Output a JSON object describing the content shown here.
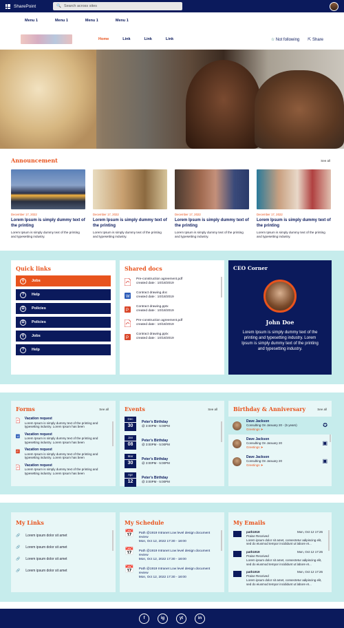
{
  "topbar": {
    "app_name": "SharePoint",
    "search_placeholder": "Search across sites"
  },
  "menu": [
    "Menu 1",
    "Menu 1",
    "Menu 1",
    "Menu 1"
  ],
  "site_nav": [
    "Home",
    "Link",
    "Link",
    "Link"
  ],
  "site_actions": {
    "follow": "Not following",
    "share": "Share"
  },
  "announcement": {
    "title": "Announcement",
    "see_all": "See all",
    "cards": [
      {
        "date": "December 17, 2022",
        "title": "Lorem Ipsum is simply dummy text of the printing",
        "desc": "Lorem Ipsum is simply dummy text of the printing and typesetting industry."
      },
      {
        "date": "December 17, 2022",
        "title": "Lorem Ipsum is simply dummy text of the printing",
        "desc": "Lorem Ipsum is simply dummy text of the printing and typesetting industry."
      },
      {
        "date": "December 17, 2022",
        "title": "Lorem Ipsum is simply dummy text of the printing",
        "desc": "Lorem Ipsum is simply dummy text of the printing and typesetting industry."
      },
      {
        "date": "December 17, 2022",
        "title": "Lorem Ipsum is simply dummy text of the printing",
        "desc": "Lorem Ipsum is simply dummy text of the printing and typesetting industry."
      }
    ]
  },
  "quick_links": {
    "title": "Quick links",
    "items": [
      "Jobs",
      "Help",
      "Policies",
      "Policies",
      "Jobs",
      "Help"
    ]
  },
  "shared_docs": {
    "title": "Shared docs",
    "items": [
      {
        "name": "Pre-construction agreement.pdf",
        "created": "created date : 10/18/2019",
        "kind": "pdf"
      },
      {
        "name": "Contract drawing.doc",
        "created": "created date : 10/18/2019",
        "kind": "doc"
      },
      {
        "name": "Contract drawing.pptx",
        "created": "created date : 10/18/2019",
        "kind": "ppt"
      },
      {
        "name": "Pre-construction agreement.pdf",
        "created": "created date : 10/18/2019",
        "kind": "pdf"
      },
      {
        "name": "Contract drawing.pptx",
        "created": "created date : 10/18/2019",
        "kind": "ppt"
      }
    ]
  },
  "ceo": {
    "title": "CEO Corner",
    "name": "John Doe",
    "text": "Lorem Ipsum is simply dummy text of the printing and typesetting industry. Lorem Ipsum is simply dummy text of the printing and typesetting industry."
  },
  "forms": {
    "title": "Forms",
    "see_all": "See all",
    "items": [
      {
        "title": "Vacation request",
        "desc": "Lorem Ipsum is simply dummy text of the printing and typesetting industry. Lorem Ipsum has been",
        "kind": "pdf"
      },
      {
        "title": "Vacation request",
        "desc": "Lorem Ipsum is simply dummy text of the printing and typesetting industry. Lorem Ipsum has been",
        "kind": "doc"
      },
      {
        "title": "Vacation request",
        "desc": "Lorem Ipsum is simply dummy text of the printing and typesetting industry. Lorem Ipsum has been",
        "kind": "ppt"
      },
      {
        "title": "Vacation request",
        "desc": "Lorem Ipsum is simply dummy text of the printing and typesetting industry. Lorem Ipsum has been",
        "kind": "pdf"
      }
    ]
  },
  "events": {
    "title": "Events",
    "see_all": "See all",
    "items": [
      {
        "month": "Dec",
        "day": "30",
        "title": "Peter's Birthday",
        "time": "@ 3:00PM - 5:00PM"
      },
      {
        "month": "Jan",
        "day": "08",
        "title": "Peter's Birthday",
        "time": "@ 3:00PM - 5:00PM"
      },
      {
        "month": "Mar",
        "day": "30",
        "title": "Peter's Birthday",
        "time": "@ 3:00PM - 5:00PM"
      },
      {
        "month": "Apr",
        "day": "12",
        "title": "Peter's Birthday",
        "time": "@ 3:00PM - 5:00PM"
      }
    ]
  },
  "birthday": {
    "title": "Birthday & Anniversary",
    "see_all": "See all",
    "items": [
      {
        "name": "Dave Jackson",
        "info": "Consulting On January 20 - (5 years)",
        "action": "Greetings"
      },
      {
        "name": "Dave Jackson",
        "info": "Consulting On January 20",
        "action": "Greetings"
      },
      {
        "name": "Dave Jackson",
        "info": "Consulting On January 20",
        "action": "Greetings"
      }
    ]
  },
  "my_links": {
    "title": "My Links",
    "items": [
      "Lorem ipsum dolor sit amet",
      "Lorem ipsum dolor sit amet",
      "Lorem ipsum dolor sit amet",
      "Lorem ipsum dolor sit amet"
    ]
  },
  "my_schedule": {
    "title": "My Schedule",
    "items": [
      {
        "title": "Path @1919 Intranet Low level design document review",
        "time": "Mon, Oct 12, 2022 17:30 - 18:00"
      },
      {
        "title": "Path @1919 Intranet Low level design document review",
        "time": "Mon, Oct 12, 2022 17:30 - 18:00"
      },
      {
        "title": "Path @1919 Intranet Low level design document review",
        "time": "Mon, Oct 12, 2022 17:30 - 18:00"
      }
    ]
  },
  "my_emails": {
    "title": "My Emails",
    "items": [
      {
        "from": "path1919",
        "date": "Mon, Oct 12 17:26",
        "subject": "Praise Received",
        "body": "Lorem ipsum dolor sit amet, consectetur adipiscing elit, sed do eiusmod tempor incididunt ut labore et..."
      },
      {
        "from": "path1919",
        "date": "Mon, Oct 12 17:26",
        "subject": "Praise Received",
        "body": "Lorem ipsum dolor sit amet, consectetur adipiscing elit, sed do eiusmod tempor incididunt ut labore et..."
      },
      {
        "from": "path1919",
        "date": "Mon, Oct 12 17:26",
        "subject": "Praise Received",
        "body": "Lorem ipsum dolor sit amet, consectetur adipiscing elit, sed do eiusmod tempor incididunt ut labore et..."
      }
    ]
  },
  "footer": {
    "social": [
      "f",
      "ig",
      "yt",
      "in"
    ]
  },
  "colors": {
    "navy": "#0b1a5c",
    "orange": "#e8531d",
    "teal": "#c6ecec"
  }
}
